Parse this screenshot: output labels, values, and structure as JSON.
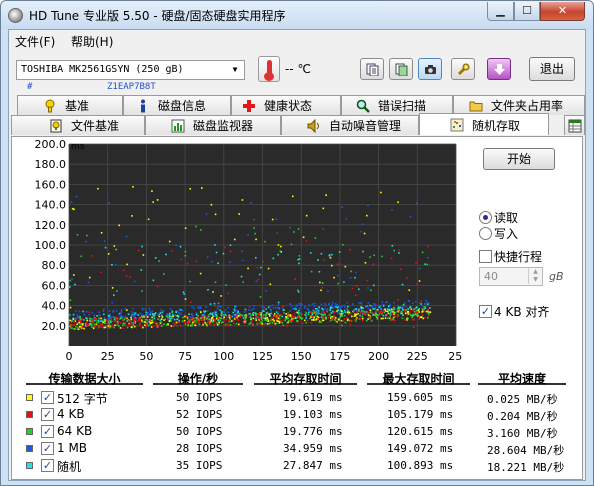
{
  "window": {
    "title": "HD Tune 专业版 5.50 - 硬盘/固态硬盘实用程序"
  },
  "menu": [
    "文件(F)",
    "帮助(H)"
  ],
  "drive": {
    "name": "TOSHIBA MK2561GSYN (250 gB)",
    "serial_hash": "#",
    "serial": "Z1EAP7B8T"
  },
  "temperature": "-- ℃",
  "toolbar": {
    "icons": [
      "copy-text-icon",
      "copy-info-icon",
      "screenshot-camera-icon",
      "options-wrench-icon",
      "save-down-arrow-icon"
    ],
    "exit_label": "退出"
  },
  "tabs_row1": [
    {
      "label": "基准",
      "icon": "benchmark-icon"
    },
    {
      "label": "磁盘信息",
      "icon": "info-icon"
    },
    {
      "label": "健康状态",
      "icon": "health-cross-icon"
    },
    {
      "label": "错误扫描",
      "icon": "magnifier-icon"
    },
    {
      "label": "文件夹占用率",
      "icon": "folder-icon"
    }
  ],
  "tabs_row2": [
    {
      "label": "文件基准",
      "icon": "file-benchmark-icon"
    },
    {
      "label": "磁盘监视器",
      "icon": "disk-monitor-icon"
    },
    {
      "label": "自动噪音管理",
      "icon": "speaker-icon"
    },
    {
      "label": "随机存取",
      "icon": "random-access-icon",
      "active": true
    }
  ],
  "controls": {
    "start_label": "开始",
    "read_label": "读取",
    "write_label": "写入",
    "read_selected": true,
    "short_stroke_label": "快捷行程",
    "short_stroke_checked": false,
    "short_stroke_value": "40",
    "short_stroke_unit": "gB",
    "align_label": "4 KB 对齐",
    "align_checked": true
  },
  "chart_data": {
    "type": "scatter",
    "title": "",
    "ylabel": "ms",
    "xlabel": "gB",
    "ylim": [
      0,
      200
    ],
    "xlim": [
      0,
      250
    ],
    "y_ticks": [
      "200.0",
      "180.0",
      "160.0",
      "140.0",
      "120.0",
      "100.0",
      "80.0",
      "60.0",
      "40.0",
      "20.0"
    ],
    "x_ticks": [
      "0",
      "25",
      "50",
      "75",
      "100",
      "125",
      "150",
      "175",
      "200",
      "225",
      "250gB"
    ],
    "grid": true,
    "background": "#2a2a2a",
    "series": [
      {
        "name": "512 字节",
        "color": "#ffff00",
        "avg_ms": 19.619,
        "max_ms": 159.605
      },
      {
        "name": "4 KB",
        "color": "#e81010",
        "avg_ms": 19.103,
        "max_ms": 105.179
      },
      {
        "name": "64 KB",
        "color": "#22d022",
        "avg_ms": 19.776,
        "max_ms": 120.615
      },
      {
        "name": "1 MB",
        "color": "#1a5ae0",
        "avg_ms": 34.959,
        "max_ms": 149.072
      },
      {
        "name": "随机",
        "color": "#20e0e8",
        "avg_ms": 27.847,
        "max_ms": 100.893
      }
    ]
  },
  "table": {
    "headers": [
      "传输数据大小",
      "操作/秒",
      "平均存取时间",
      "最大存取时间",
      "平均速度"
    ],
    "rows": [
      {
        "label": "512 字节",
        "color": "#ffff00",
        "checked": true,
        "ops": "50 IOPS",
        "avg": "19.619 ms",
        "max": "159.605 ms",
        "speed": "0.025 MB/秒"
      },
      {
        "label": "4 KB",
        "color": "#e81010",
        "checked": true,
        "ops": "52 IOPS",
        "avg": "19.103 ms",
        "max": "105.179 ms",
        "speed": "0.204 MB/秒"
      },
      {
        "label": "64 KB",
        "color": "#22d022",
        "checked": true,
        "ops": "50 IOPS",
        "avg": "19.776 ms",
        "max": "120.615 ms",
        "speed": "3.160 MB/秒"
      },
      {
        "label": "1 MB",
        "color": "#1a5ae0",
        "checked": true,
        "ops": "28 IOPS",
        "avg": "34.959 ms",
        "max": "149.072 ms",
        "speed": "28.604 MB/秒"
      },
      {
        "label": "随机",
        "color": "#20e0e8",
        "checked": true,
        "ops": "35 IOPS",
        "avg": "27.847 ms",
        "max": "100.893 ms",
        "speed": "18.221 MB/秒"
      }
    ]
  }
}
